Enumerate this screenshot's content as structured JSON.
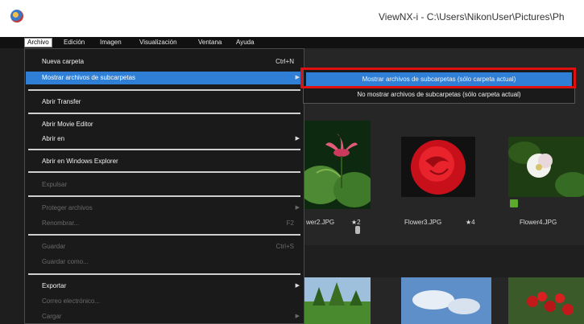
{
  "window": {
    "title": "ViewNX-i - C:\\Users\\NikonUser\\Pictures\\Ph"
  },
  "menubar": [
    "Archivo",
    "Edición",
    "Imagen",
    "Visualización",
    "Ventana",
    "Ayuda"
  ],
  "file_menu": {
    "items": [
      {
        "label": "Nueva carpeta",
        "shortcut": "Ctrl+N"
      },
      {
        "label": "Mostrar archivos de subcarpetas"
      },
      {
        "label": "Abrir Transfer"
      },
      {
        "label": "Abrir Movie Editor"
      },
      {
        "label": "Abrir en"
      },
      {
        "label": "Abrir en Windows Explorer"
      },
      {
        "label": "Expulsar"
      },
      {
        "label": "Proteger archivos"
      },
      {
        "label": "Renombrar...",
        "shortcut": "F2"
      },
      {
        "label": "Guardar",
        "shortcut": "Ctrl+S"
      },
      {
        "label": "Guardar como..."
      },
      {
        "label": "Exportar"
      },
      {
        "label": "Correo electrónico..."
      },
      {
        "label": "Cargar"
      }
    ]
  },
  "submenu": {
    "items": [
      {
        "label": "Mostrar archivos de subcarpetas (sólo carpeta actual)"
      },
      {
        "label": "No mostrar archivos de subcarpetas (sólo carpeta actual)"
      }
    ]
  },
  "thumbnails": [
    {
      "label": "wer2.JPG",
      "rating": "★2"
    },
    {
      "label": "Flower3.JPG",
      "rating": "★4"
    },
    {
      "label": "Flower4.JPG"
    }
  ],
  "colors": {
    "highlight": "#2f7fd6",
    "callout": "#e01010"
  }
}
